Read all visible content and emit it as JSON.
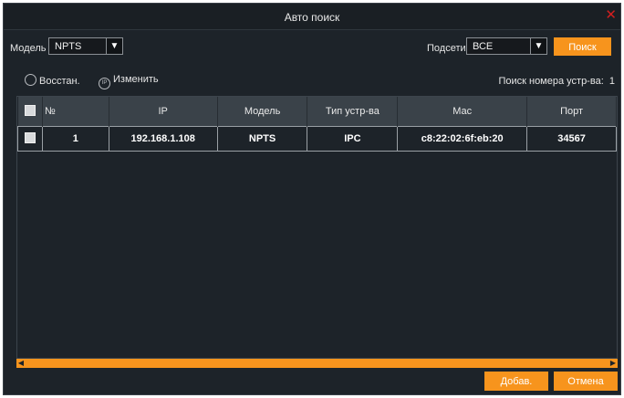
{
  "dialog": {
    "title": "Авто поиск",
    "close_glyph": "✕"
  },
  "filters": {
    "model_label": "Модель",
    "model_value": "NPTS",
    "subnet_label": "Подсети",
    "subnet_value": "ВСЕ",
    "search_button": "Поиск"
  },
  "toolbar": {
    "restore_label": "Восстан.",
    "change_label": "Изменить",
    "ip_icon_text": "IP",
    "device_count_label": "Поиск номера устр-ва:",
    "device_count": "1"
  },
  "table": {
    "headers": [
      "№",
      "IP",
      "Модель",
      "Тип устр-ва",
      "Mac",
      "Порт"
    ],
    "rows": [
      {
        "no": "1",
        "ip": "192.168.1.108",
        "model": "NPTS",
        "type": "IPC",
        "mac": "c8:22:02:6f:eb:20",
        "port": "34567"
      }
    ]
  },
  "footer": {
    "add_button": "Добав.",
    "cancel_button": "Отмена"
  },
  "colors": {
    "accent": "#f7941d",
    "background": "#1d2329",
    "header": "#3a4249",
    "close": "#d21f1f"
  }
}
